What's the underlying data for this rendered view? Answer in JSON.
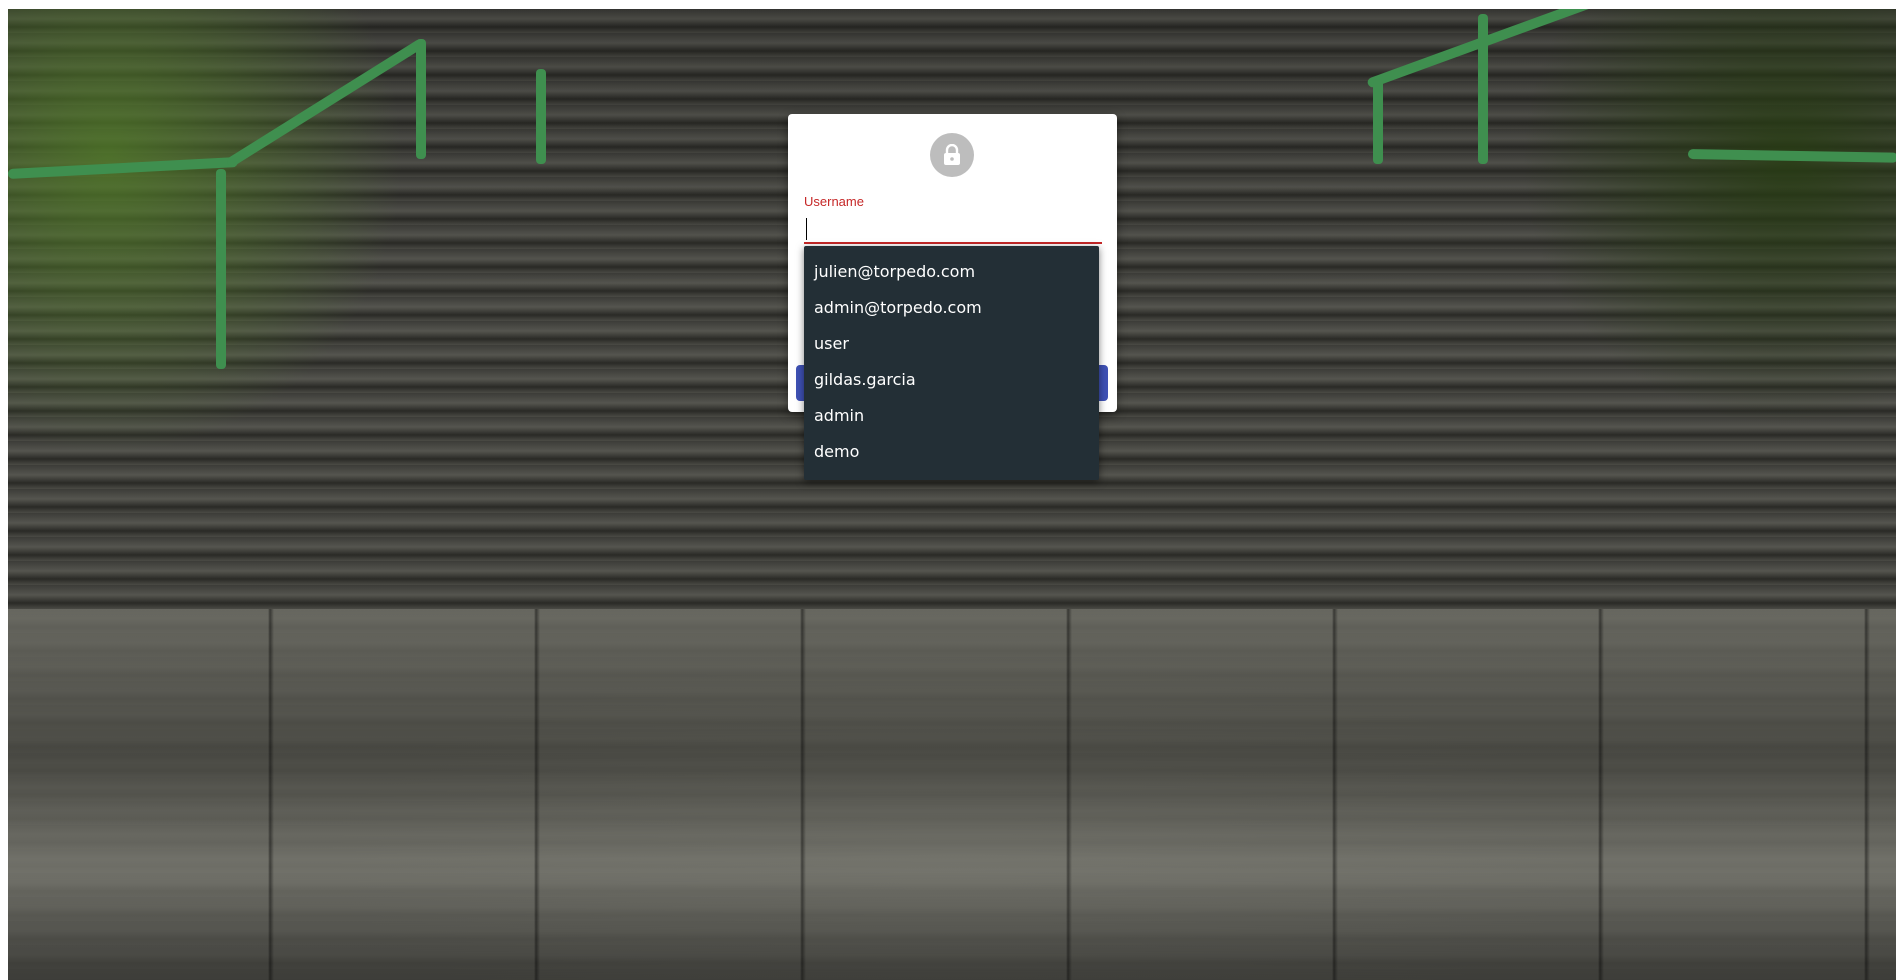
{
  "login": {
    "username_label": "Username",
    "username_value": "",
    "lock_icon": "lock-icon",
    "accent_color": "#c62828",
    "button_color": "#3f51b5"
  },
  "autocomplete": {
    "options": [
      "julien@torpedo.com",
      "admin@torpedo.com",
      "user",
      "gildas.garcia",
      "admin",
      "demo"
    ]
  }
}
